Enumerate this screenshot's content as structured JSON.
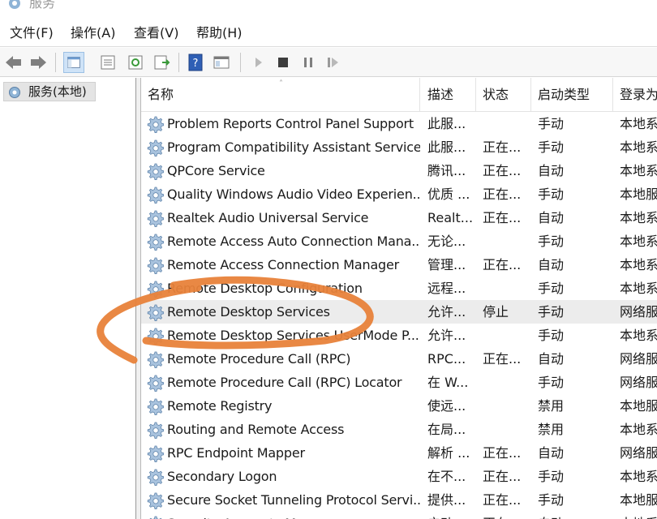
{
  "window": {
    "title": "服务"
  },
  "menu": [
    {
      "label": "文件(F)"
    },
    {
      "label": "操作(A)"
    },
    {
      "label": "查看(V)"
    },
    {
      "label": "帮助(H)"
    }
  ],
  "tree": {
    "root_label": "服务(本地)"
  },
  "columns": {
    "name": "名称",
    "desc": "描述",
    "status": "状态",
    "startup": "启动类型",
    "logon": "登录为"
  },
  "services": [
    {
      "name": "Problem Reports Control Panel Support",
      "desc": "此服...",
      "status": "",
      "startup": "手动",
      "logon": "本地系"
    },
    {
      "name": "Program Compatibility Assistant Service",
      "desc": "此服...",
      "status": "正在...",
      "startup": "手动",
      "logon": "本地系"
    },
    {
      "name": "QPCore Service",
      "desc": "腾讯...",
      "status": "正在...",
      "startup": "自动",
      "logon": "本地系"
    },
    {
      "name": "Quality Windows Audio Video Experien...",
      "desc": "优质 ...",
      "status": "正在...",
      "startup": "手动",
      "logon": "本地服"
    },
    {
      "name": "Realtek Audio Universal Service",
      "desc": "Realt...",
      "status": "正在...",
      "startup": "自动",
      "logon": "本地系"
    },
    {
      "name": "Remote Access Auto Connection Mana...",
      "desc": "无论...",
      "status": "",
      "startup": "手动",
      "logon": "本地系"
    },
    {
      "name": "Remote Access Connection Manager",
      "desc": "管理...",
      "status": "正在...",
      "startup": "自动",
      "logon": "本地系"
    },
    {
      "name": "Remote Desktop Configuration",
      "desc": "远程...",
      "status": "",
      "startup": "手动",
      "logon": "本地系"
    },
    {
      "name": "Remote Desktop Services",
      "desc": "允许...",
      "status": "停止",
      "startup": "手动",
      "logon": "网络服"
    },
    {
      "name": "Remote Desktop Services UserMode P...",
      "desc": "允许...",
      "status": "",
      "startup": "手动",
      "logon": "本地系"
    },
    {
      "name": "Remote Procedure Call (RPC)",
      "desc": "RPC...",
      "status": "正在...",
      "startup": "自动",
      "logon": "网络服"
    },
    {
      "name": "Remote Procedure Call (RPC) Locator",
      "desc": "在 W...",
      "status": "",
      "startup": "手动",
      "logon": "网络服"
    },
    {
      "name": "Remote Registry",
      "desc": "使远...",
      "status": "",
      "startup": "禁用",
      "logon": "本地服"
    },
    {
      "name": "Routing and Remote Access",
      "desc": "在局...",
      "status": "",
      "startup": "禁用",
      "logon": "本地系"
    },
    {
      "name": "RPC Endpoint Mapper",
      "desc": "解析 ...",
      "status": "正在...",
      "startup": "自动",
      "logon": "网络服"
    },
    {
      "name": "Secondary Logon",
      "desc": "在不...",
      "status": "正在...",
      "startup": "手动",
      "logon": "本地系"
    },
    {
      "name": "Secure Socket Tunneling Protocol Servi...",
      "desc": "提供...",
      "status": "正在...",
      "startup": "手动",
      "logon": "本地服"
    },
    {
      "name": "Security Accounts Manager",
      "desc": "启动...",
      "status": "正在...",
      "startup": "自动",
      "logon": "本地系"
    }
  ],
  "selected_service": "Remote Desktop Services",
  "colors": {
    "annotation_stroke": "#e8823a",
    "selected_row": "#ececec",
    "pane_border": "#9a9a9a"
  },
  "icons": [
    "services-app-icon",
    "back-arrow-icon",
    "forward-arrow-icon",
    "console-tree-icon",
    "properties-icon",
    "refresh-icon",
    "export-list-icon",
    "help-icon",
    "mmc-icon",
    "play-icon",
    "stop-icon",
    "pause-icon",
    "restart-icon",
    "service-gear-icon"
  ]
}
